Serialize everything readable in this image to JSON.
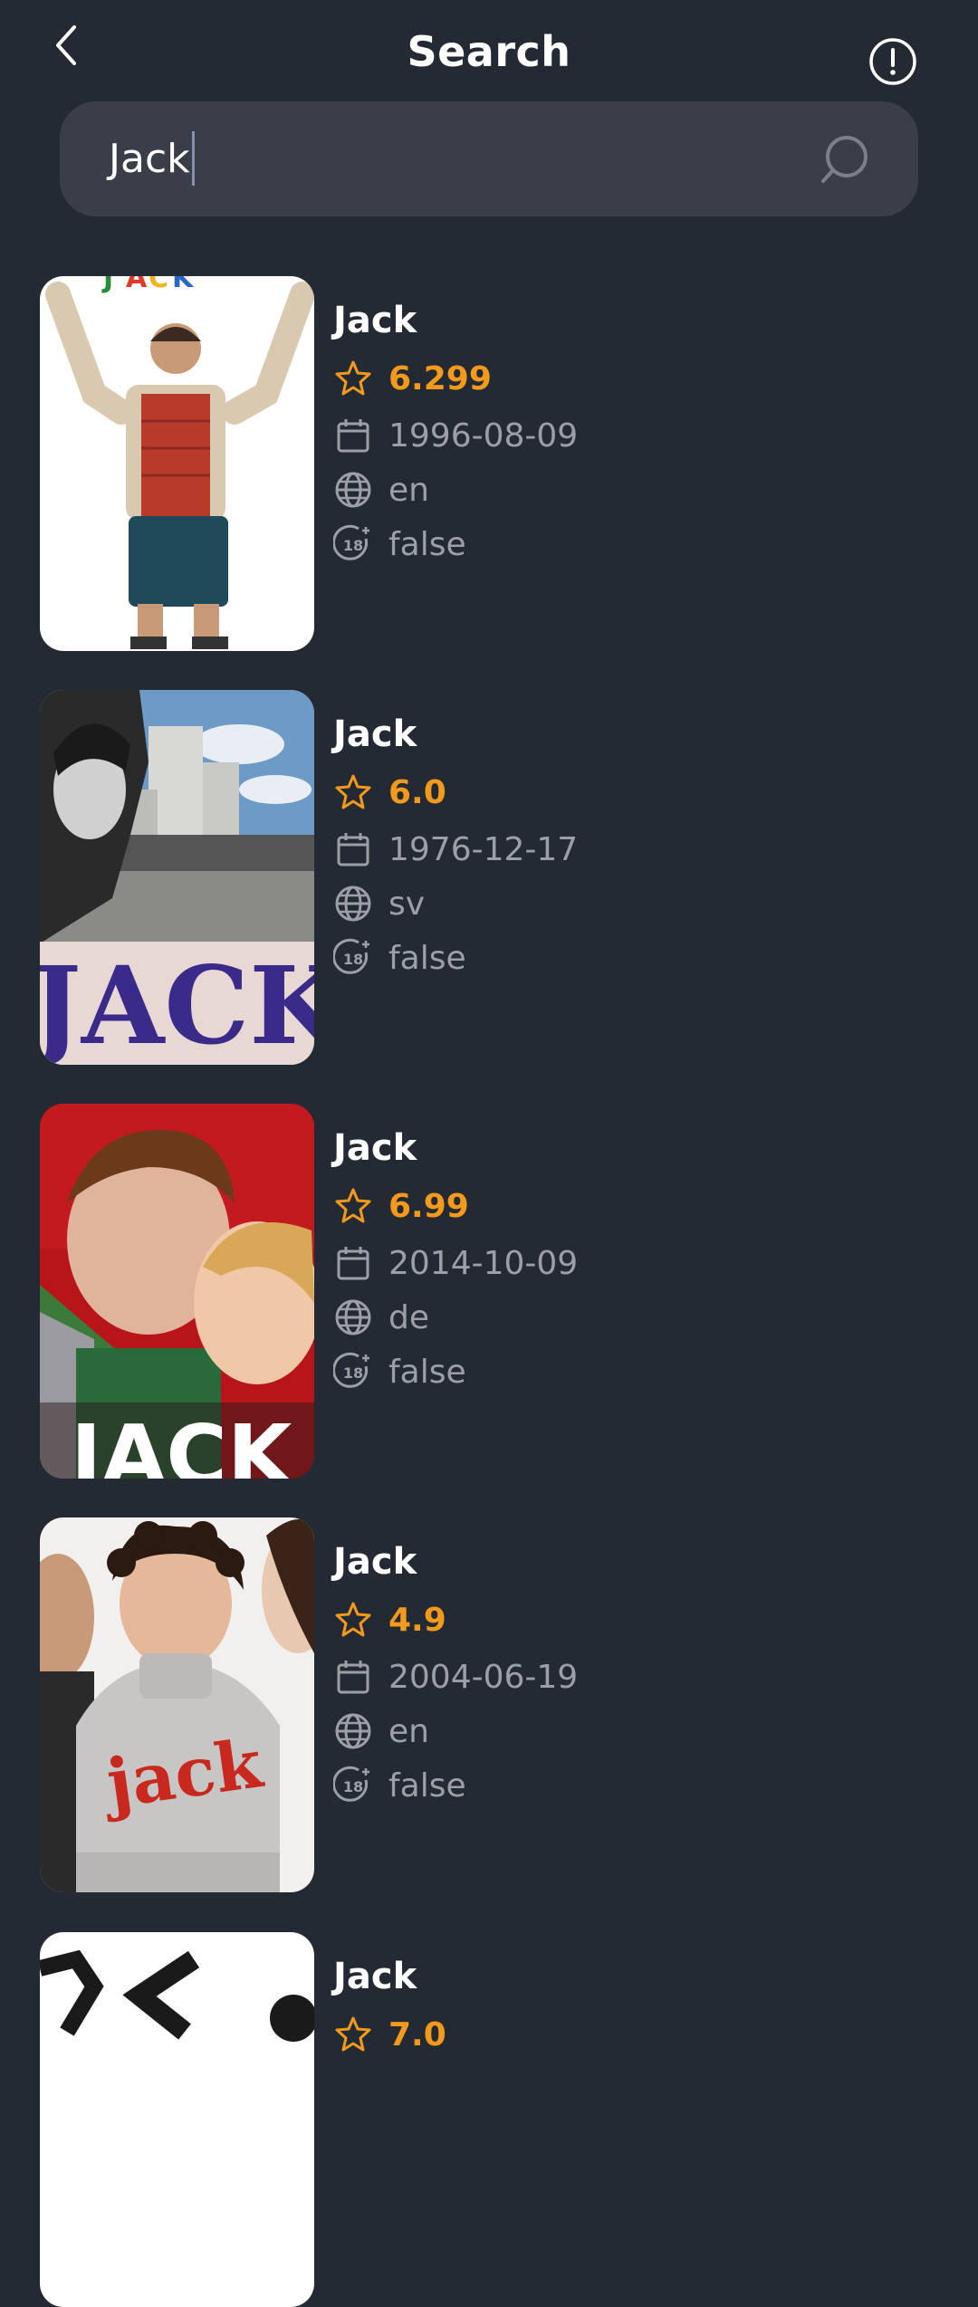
{
  "header": {
    "title": "Search"
  },
  "search": {
    "value": "Jack"
  },
  "results": [
    {
      "title": "Jack",
      "rating": "6.299",
      "date": "1996-08-09",
      "language": "en",
      "adult": "false"
    },
    {
      "title": "Jack",
      "rating": "6.0",
      "date": "1976-12-17",
      "language": "sv",
      "adult": "false"
    },
    {
      "title": "Jack",
      "rating": "6.99",
      "date": "2014-10-09",
      "language": "de",
      "adult": "false"
    },
    {
      "title": "Jack",
      "rating": "4.9",
      "date": "2004-06-19",
      "language": "en",
      "adult": "false"
    },
    {
      "title": "Jack",
      "rating": "7.0"
    }
  ],
  "icons": {
    "rating": "star-icon",
    "date": "calendar-icon",
    "language": "globe-icon",
    "adult": "age-18-icon"
  },
  "colors": {
    "background": "#242a33",
    "search_bg": "#393e48",
    "accent": "#f39a1d",
    "muted_text": "#9d9fa6"
  }
}
